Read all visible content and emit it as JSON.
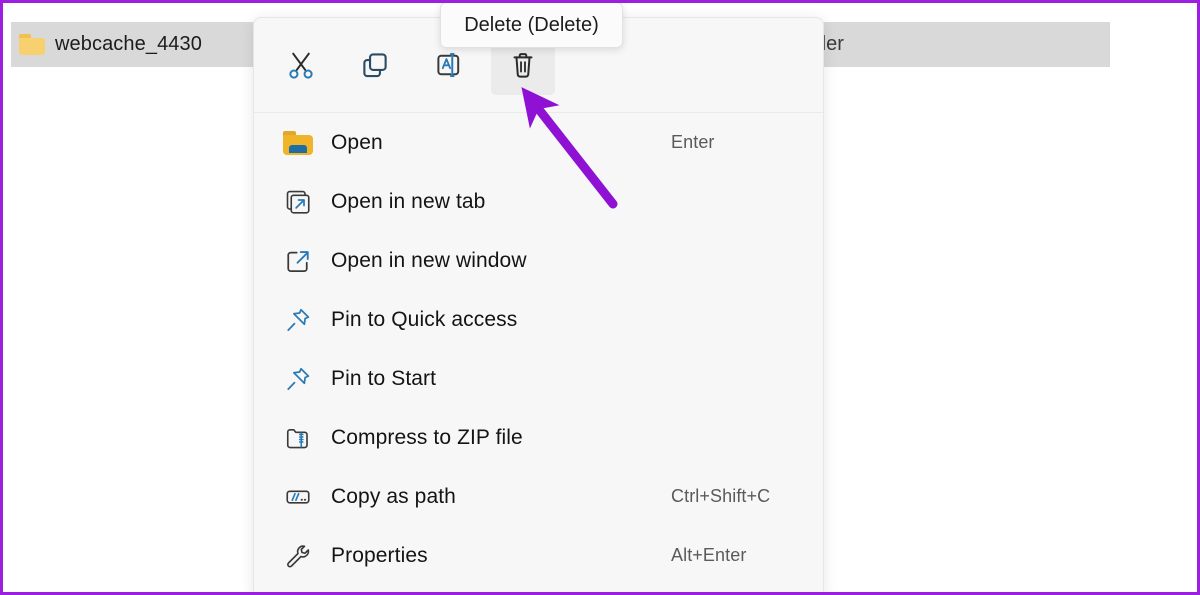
{
  "window": {
    "border_color": "#9b1fe0",
    "background": "#ffffff"
  },
  "file_list": {
    "selected_row": {
      "icon": "folder-icon",
      "name": "webcache_4430",
      "type_column": "der",
      "selected": true,
      "background": "#d9d9d9"
    }
  },
  "context_menu": {
    "background": "#f7f7f7",
    "toolbar": [
      {
        "name": "cut",
        "icon": "scissors-icon",
        "label": "Cut",
        "hovered": false
      },
      {
        "name": "copy",
        "icon": "copy-icon",
        "label": "Copy",
        "hovered": false
      },
      {
        "name": "rename",
        "icon": "rename-icon",
        "label": "Rename",
        "hovered": false
      },
      {
        "name": "delete",
        "icon": "trash-icon",
        "label": "Delete",
        "hovered": true
      }
    ],
    "items": [
      {
        "icon": "folder-open-icon",
        "label": "Open",
        "shortcut": "Enter"
      },
      {
        "icon": "open-new-tab-icon",
        "label": "Open in new tab",
        "shortcut": ""
      },
      {
        "icon": "open-new-window-icon",
        "label": "Open in new window",
        "shortcut": ""
      },
      {
        "icon": "pin-icon",
        "label": "Pin to Quick access",
        "shortcut": ""
      },
      {
        "icon": "pin-icon",
        "label": "Pin to Start",
        "shortcut": ""
      },
      {
        "icon": "zip-folder-icon",
        "label": "Compress to ZIP file",
        "shortcut": ""
      },
      {
        "icon": "copy-path-icon",
        "label": "Copy as path",
        "shortcut": "Ctrl+Shift+C"
      },
      {
        "icon": "wrench-icon",
        "label": "Properties",
        "shortcut": "Alt+Enter"
      }
    ]
  },
  "tooltip": {
    "text": "Delete (Delete)",
    "target": "delete-toolbar-button"
  },
  "annotation": {
    "arrow_color": "#8f12d4",
    "points_to": "delete-toolbar-button"
  }
}
